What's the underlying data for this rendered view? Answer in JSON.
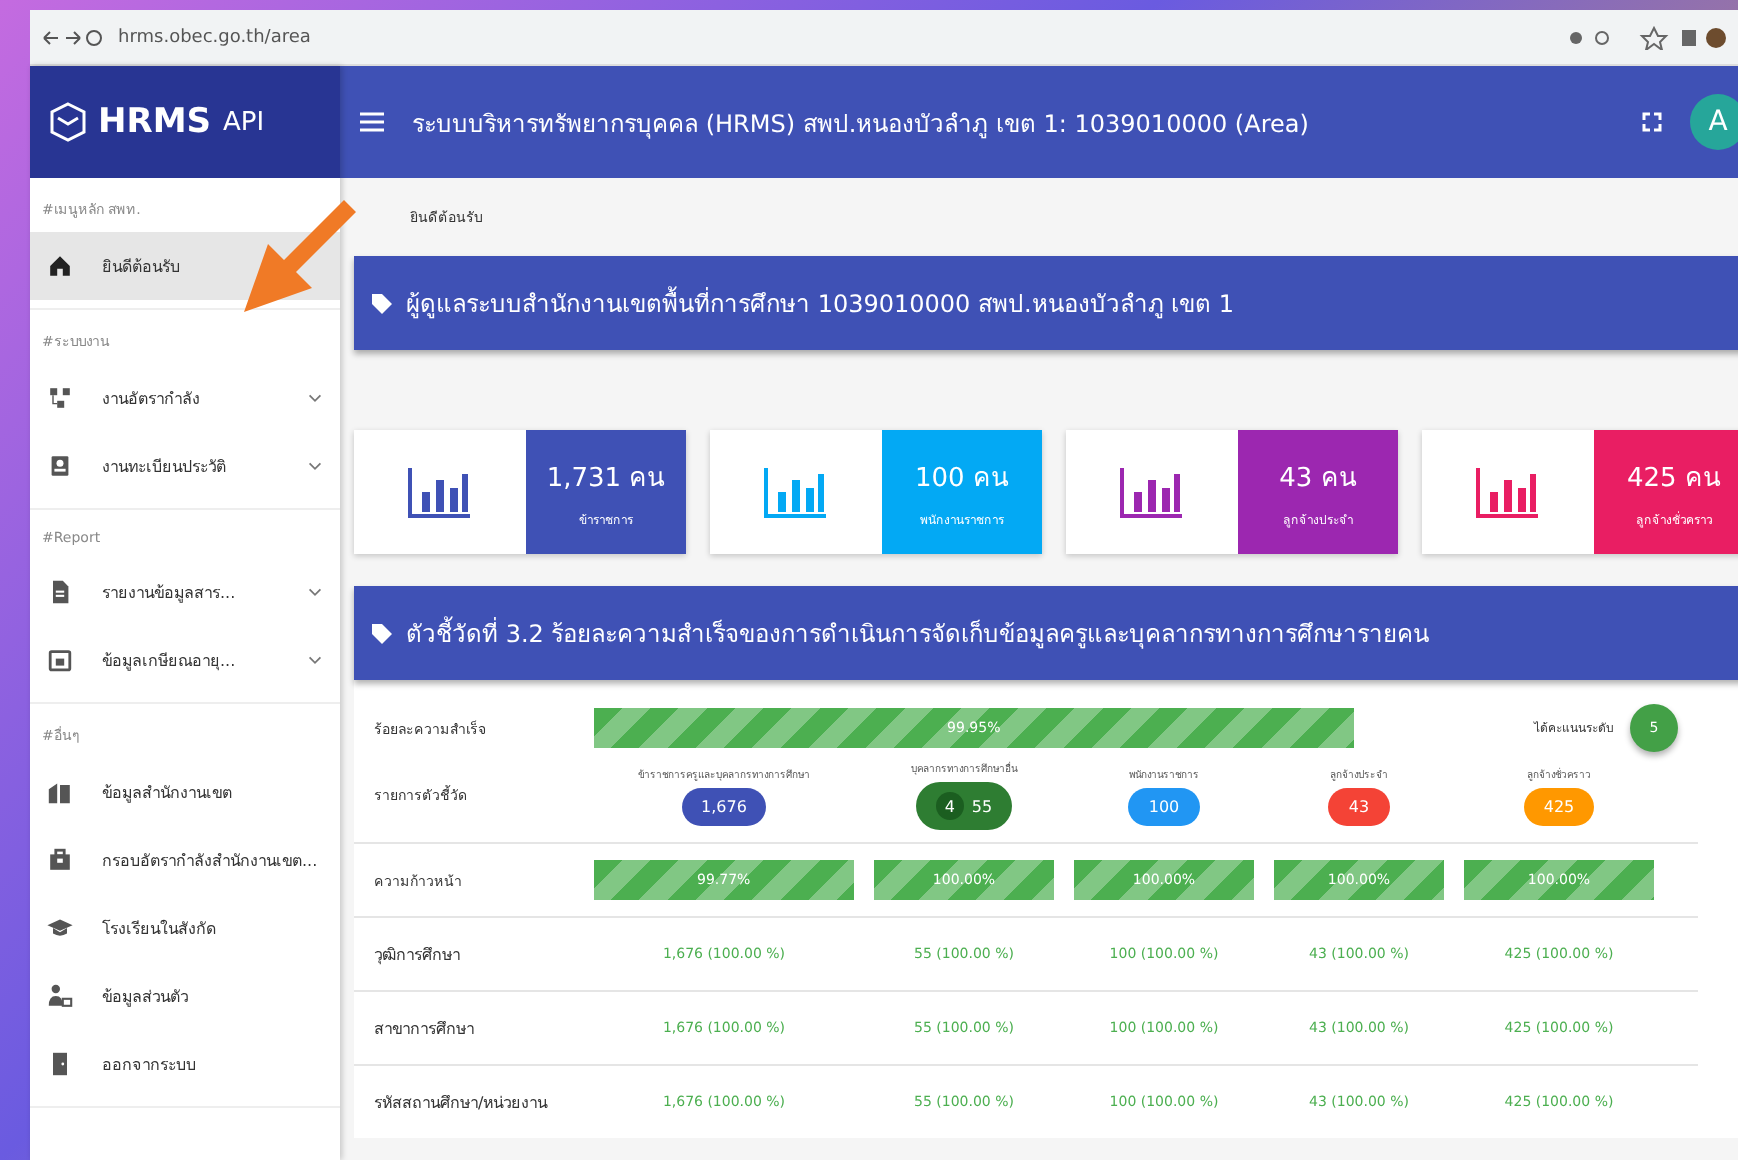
{
  "browser": {
    "url": "hrms.obec.go.th/area"
  },
  "app_header": {
    "logo": "HRMS",
    "logo_suffix": "API",
    "title": "ระบบบริหารทรัพยากรบุคคล (HRMS) สพป.หนองบัวลำภู เขต 1: 1039010000 (Area)",
    "avatar": "A"
  },
  "sidebar": {
    "sections": [
      {
        "heading": "#เมนูหลัก สพท.",
        "items": [
          {
            "label": "ยินดีต้อนรับ",
            "selected": true,
            "expandable": false
          }
        ]
      },
      {
        "heading": "#ระบบงาน",
        "items": [
          {
            "label": "งานอัตรากำลัง",
            "selected": false,
            "expandable": true
          },
          {
            "label": "งานทะเบียนประวัติ",
            "selected": false,
            "expandable": true
          }
        ]
      },
      {
        "heading": "#Report",
        "items": [
          {
            "label": "รายงานข้อมูลสาร...",
            "selected": false,
            "expandable": true
          },
          {
            "label": "ข้อมูลเกษียณอายุ...",
            "selected": false,
            "expandable": true
          }
        ]
      },
      {
        "heading": "#อื่นๆ",
        "items": [
          {
            "label": "ข้อมูลสำนักงานเขต",
            "selected": false,
            "expandable": false
          },
          {
            "label": "กรอบอัตรากำลังสำนักงานเขต...",
            "selected": false,
            "expandable": false
          },
          {
            "label": "โรงเรียนในสังกัด",
            "selected": false,
            "expandable": false
          },
          {
            "label": "ข้อมูลส่วนตัว",
            "selected": false,
            "expandable": false
          },
          {
            "label": "ออกจากระบบ",
            "selected": false,
            "expandable": false
          }
        ]
      }
    ]
  },
  "breadcrumb": "ยินดีต้อนรับ",
  "banner": "ผู้ดูแลระบบสำนักงานเขตพื้นที่การศึกษา 1039010000 สพป.หนองบัวลำภู เขต 1",
  "stats": [
    {
      "value": "1,731 คน",
      "label": "ข้าราชการ",
      "color": "#3f51b5"
    },
    {
      "value": "100 คน",
      "label": "พนักงานราชการ",
      "color": "#03a9f4"
    },
    {
      "value": "43 คน",
      "label": "ลูกจ้างประจำ",
      "color": "#9c27b0"
    },
    {
      "value": "425 คน",
      "label": "ลูกจ้างชั่วคราว",
      "color": "#e91e63"
    }
  ],
  "indicator": {
    "title": "ตัวชี้วัดที่ 3.2 ร้อยละความสำเร็จของการดำเนินการจัดเก็บข้อมูลครูและบุคลากรทางการศึกษารายคน",
    "success": {
      "label": "ร้อยละความสำเร็จ",
      "level": 0.9995,
      "reading": "99.95%"
    },
    "score_label": "ได้คะแนนระดับ",
    "score": "5",
    "items_label": "รายการตัวชี้วัด",
    "categories": [
      {
        "label": "ข้าราชการครูและบุคลากรทางการศึกษา",
        "count": "1,676",
        "color": "#3f51b5"
      },
      {
        "label": "บุคลากรทางการศึกษาอื่น",
        "extra": "4",
        "count": "55",
        "color": "#2e7d32"
      },
      {
        "label": "พนักงานราชการ",
        "count": "100",
        "color": "#2196f3"
      },
      {
        "label": "ลูกจ้างประจำ",
        "count": "43",
        "color": "#f44336"
      },
      {
        "label": "ลูกจ้างชั่วคราว",
        "count": "425",
        "color": "#ff9800"
      }
    ],
    "progress_label": "ความก้าวหน้า",
    "progress": [
      {
        "level": 0.9977,
        "reading": "99.77%"
      },
      {
        "level": 1,
        "reading": "100.00%"
      },
      {
        "level": 1,
        "reading": "100.00%"
      },
      {
        "level": 1,
        "reading": "100.00%"
      },
      {
        "level": 1,
        "reading": "100.00%"
      }
    ],
    "rows": [
      {
        "label": "วุฒิการศึกษา",
        "values": [
          "1,676 (100.00 %)",
          "55 (100.00 %)",
          "100 (100.00 %)",
          "43 (100.00 %)",
          "425 (100.00 %)"
        ]
      },
      {
        "label": "สาขาการศึกษา",
        "values": [
          "1,676 (100.00 %)",
          "55 (100.00 %)",
          "100 (100.00 %)",
          "43 (100.00 %)",
          "425 (100.00 %)"
        ]
      },
      {
        "label": "รหัสสถานศึกษา/หน่วยงาน",
        "values": [
          "1,676 (100.00 %)",
          "55 (100.00 %)",
          "100 (100.00 %)",
          "43 (100.00 %)",
          "425 (100.00 %)"
        ]
      }
    ]
  }
}
